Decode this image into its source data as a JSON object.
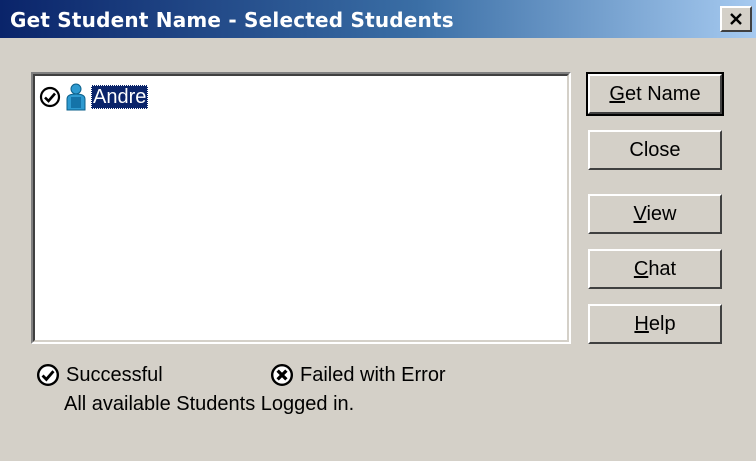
{
  "window": {
    "title": "Get Student Name - Selected Students"
  },
  "list": {
    "items": [
      {
        "name": "Andre",
        "status": "successful",
        "icon": "student-icon"
      }
    ]
  },
  "buttons": {
    "get_name": {
      "prefix": "",
      "accel": "G",
      "rest": "et Name"
    },
    "close": {
      "label": "Close"
    },
    "view": {
      "prefix": "",
      "accel": "V",
      "rest": "iew"
    },
    "chat": {
      "prefix": "",
      "accel": "C",
      "rest": "hat"
    },
    "help": {
      "prefix": "",
      "accel": "H",
      "rest": "elp"
    }
  },
  "legend": {
    "successful": "Successful",
    "failed": "Failed with Error"
  },
  "status": {
    "message": "All available Students Logged in."
  },
  "colors": {
    "title_gradient_start": "#0a246a",
    "title_gradient_end": "#a6caf0",
    "dialog_bg": "#d4d0c8",
    "selection": "#0a246a"
  }
}
